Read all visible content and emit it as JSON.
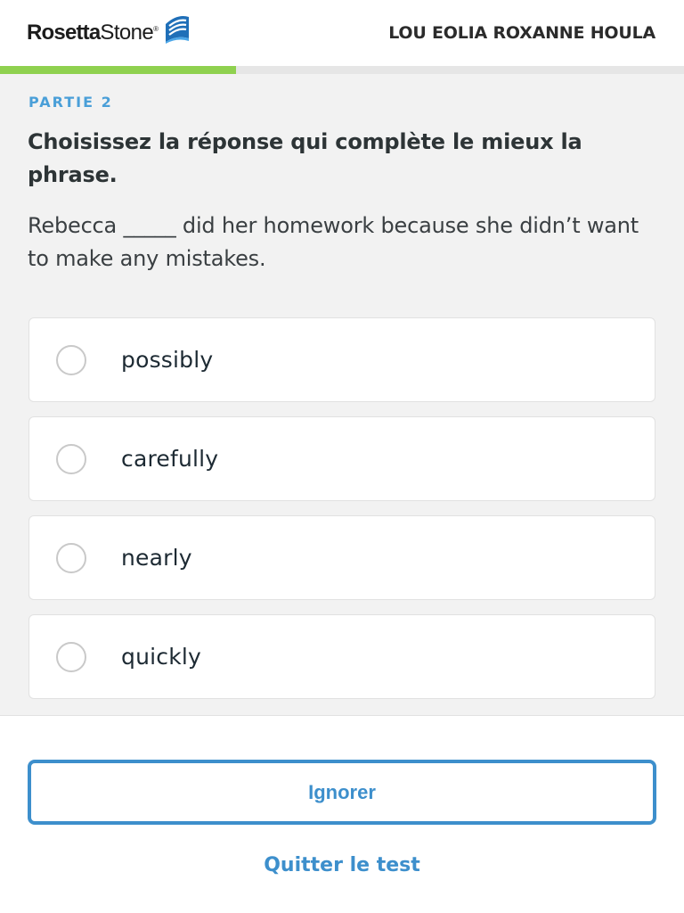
{
  "header": {
    "logo_word1": "Rosetta",
    "logo_word2": "Stone",
    "logo_mark": "®",
    "logo_icon": "rosetta-stone-logo-icon",
    "user_name": "LOU EOLIA ROXANNE HOULA"
  },
  "progress": {
    "fraction": 0.345,
    "color": "#8fd14f"
  },
  "question": {
    "part_label": "PARTIE 2",
    "instruction": "Choisissez la réponse qui complète le mieux la phrase.",
    "sentence": "Rebecca _____ did her homework because she didn’t want to make any mistakes."
  },
  "options": [
    {
      "label": "possibly"
    },
    {
      "label": "carefully"
    },
    {
      "label": "nearly"
    },
    {
      "label": "quickly"
    }
  ],
  "footer": {
    "ignore_label": "Ignorer",
    "quit_label": "Quitter le test"
  },
  "colors": {
    "accent_blue": "#3d8fcc",
    "part_label_blue": "#4a9fd8",
    "background_gray": "#f2f2f2"
  }
}
